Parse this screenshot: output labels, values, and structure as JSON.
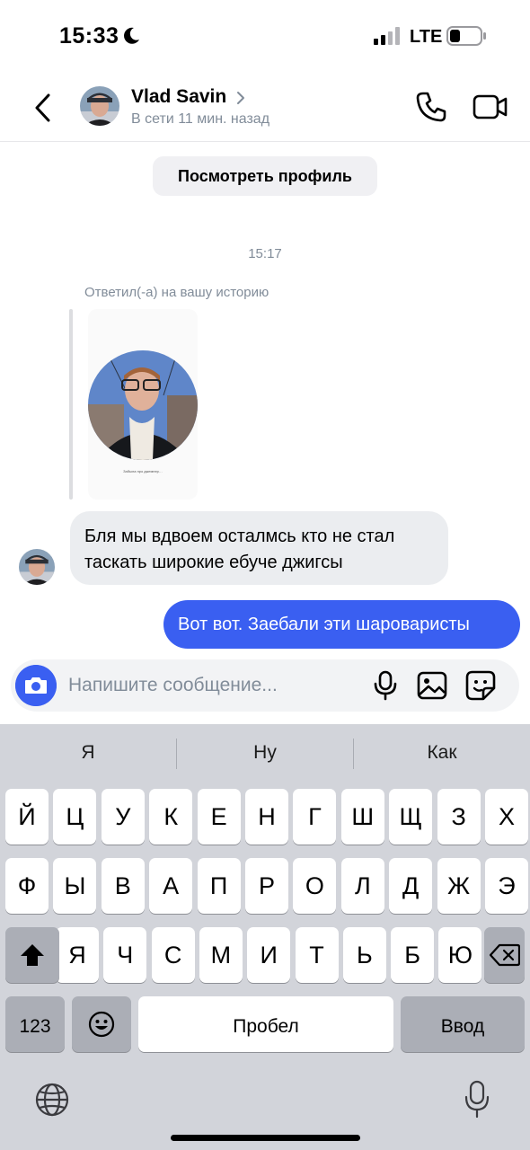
{
  "status_bar": {
    "time": "15:33",
    "network": "LTE"
  },
  "header": {
    "contact_name": "Vlad Savin",
    "contact_status": "В сети 11 мин. назад"
  },
  "chat": {
    "view_profile_label": "Посмотреть профиль",
    "time_divider": "15:17",
    "reply_caption": "Ответил(-а) на вашу историю",
    "story_caption": "Забыла про джемпер…",
    "incoming_message": "Бля мы вдвоем осталмсь кто не стал таскать широкие ебуче джигсы",
    "outgoing_message": "Вот вот. Заебали эти шароваристы"
  },
  "composer": {
    "placeholder": "Напишите сообщение..."
  },
  "keyboard": {
    "suggestions": [
      "Я",
      "Ну",
      "Как"
    ],
    "row1": [
      "Й",
      "Ц",
      "У",
      "К",
      "Е",
      "Н",
      "Г",
      "Ш",
      "Щ",
      "З",
      "Х"
    ],
    "row2": [
      "Ф",
      "Ы",
      "В",
      "А",
      "П",
      "Р",
      "О",
      "Л",
      "Д",
      "Ж",
      "Э"
    ],
    "row3": [
      "Я",
      "Ч",
      "С",
      "М",
      "И",
      "Т",
      "Ь",
      "Б",
      "Ю"
    ],
    "numbers_label": "123",
    "space_label": "Пробел",
    "return_label": "Ввод"
  },
  "colors": {
    "accent": "#3a5ff1",
    "incoming_bubble": "#ebedf0",
    "secondary_text": "#818c99",
    "keyboard_bg": "#d2d4da"
  },
  "icons": [
    "moon-icon",
    "signal-icon",
    "battery-icon",
    "back-icon",
    "chevron-right-icon",
    "phone-icon",
    "video-icon",
    "camera-icon",
    "microphone-icon",
    "image-icon",
    "sticker-icon",
    "shift-icon",
    "backspace-icon",
    "emoji-icon",
    "globe-icon"
  ]
}
